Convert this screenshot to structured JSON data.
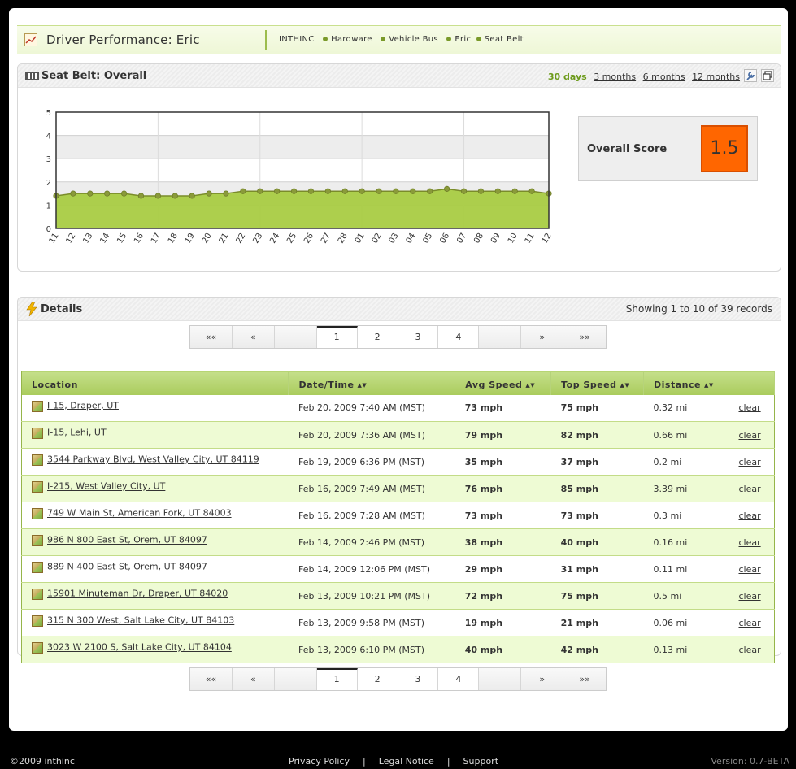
{
  "header": {
    "title": "Driver Performance: Eric",
    "breadcrumbs": [
      "INTHINC",
      "Hardware",
      "Vehicle Bus",
      "Eric",
      "Seat Belt"
    ]
  },
  "seatbelt_panel": {
    "title": "Seat Belt: Overall",
    "ranges": [
      "30 days",
      "3 months",
      "6 months",
      "12 months"
    ],
    "active_range": "30 days",
    "overall_label": "Overall Score",
    "overall_value": "1.5",
    "score_color": "#ff6600"
  },
  "chart_data": {
    "type": "area",
    "title": "",
    "xlabel": "",
    "ylabel": "",
    "ylim": [
      0,
      5
    ],
    "yticks": [
      "0",
      "1",
      "2",
      "3",
      "4",
      "5"
    ],
    "categories": [
      "11",
      "12",
      "13",
      "14",
      "15",
      "16",
      "17",
      "18",
      "19",
      "20",
      "21",
      "22",
      "23",
      "24",
      "25",
      "26",
      "27",
      "28",
      "01",
      "02",
      "03",
      "04",
      "05",
      "06",
      "07",
      "08",
      "09",
      "10",
      "11",
      "12"
    ],
    "values": [
      1.4,
      1.5,
      1.5,
      1.5,
      1.5,
      1.4,
      1.4,
      1.4,
      1.4,
      1.5,
      1.5,
      1.6,
      1.6,
      1.6,
      1.6,
      1.6,
      1.6,
      1.6,
      1.6,
      1.6,
      1.6,
      1.6,
      1.6,
      1.7,
      1.6,
      1.6,
      1.6,
      1.6,
      1.6,
      1.5
    ],
    "fill_color": "#a9cc43",
    "line_color": "#7a8c2a",
    "grid": true
  },
  "details": {
    "title": "Details",
    "showing": "Showing 1 to 10 of 39 records",
    "pager": {
      "first": "«‹",
      "prev": "«",
      "next": "»",
      "last": "»»",
      "pages": [
        "1",
        "2",
        "3",
        "4"
      ],
      "current": "1"
    },
    "columns": [
      "Location",
      "Date/Time",
      "Avg Speed",
      "Top Speed",
      "Distance"
    ],
    "clear_label": "clear",
    "rows": [
      {
        "location": "I-15, Draper, UT",
        "datetime": "Feb 20, 2009 7:40 AM (MST)",
        "avg": "73 mph",
        "top": "75 mph",
        "distance": "0.32 mi"
      },
      {
        "location": "I-15, Lehi, UT",
        "datetime": "Feb 20, 2009 7:36 AM (MST)",
        "avg": "79 mph",
        "top": "82 mph",
        "distance": "0.66 mi"
      },
      {
        "location": "3544 Parkway Blvd, West Valley City, UT 84119",
        "datetime": "Feb 19, 2009 6:36 PM (MST)",
        "avg": "35 mph",
        "top": "37 mph",
        "distance": "0.2 mi"
      },
      {
        "location": "I-215, West Valley City, UT",
        "datetime": "Feb 16, 2009 7:49 AM (MST)",
        "avg": "76 mph",
        "top": "85 mph",
        "distance": "3.39 mi"
      },
      {
        "location": "749 W Main St, American Fork, UT 84003",
        "datetime": "Feb 16, 2009 7:28 AM (MST)",
        "avg": "73 mph",
        "top": "73 mph",
        "distance": "0.3 mi"
      },
      {
        "location": "986 N 800 East St, Orem, UT 84097",
        "datetime": "Feb 14, 2009 2:46 PM (MST)",
        "avg": "38 mph",
        "top": "40 mph",
        "distance": "0.16 mi"
      },
      {
        "location": "889 N 400 East St, Orem, UT 84097",
        "datetime": "Feb 14, 2009 12:06 PM (MST)",
        "avg": "29 mph",
        "top": "31 mph",
        "distance": "0.11 mi"
      },
      {
        "location": "15901 Minuteman Dr, Draper, UT 84020",
        "datetime": "Feb 13, 2009 10:21 PM (MST)",
        "avg": "72 mph",
        "top": "75 mph",
        "distance": "0.5 mi"
      },
      {
        "location": "315 N 300 West, Salt Lake City, UT 84103",
        "datetime": "Feb 13, 2009 9:58 PM (MST)",
        "avg": "19 mph",
        "top": "21 mph",
        "distance": "0.06 mi"
      },
      {
        "location": "3023 W 2100 S, Salt Lake City, UT 84104",
        "datetime": "Feb 13, 2009 6:10 PM (MST)",
        "avg": "40 mph",
        "top": "42 mph",
        "distance": "0.13 mi"
      }
    ]
  },
  "footer": {
    "copyright": "©2009 inthinc",
    "links": [
      "Privacy Policy",
      "Legal Notice",
      "Support"
    ],
    "version": "Version: 0.7-BETA"
  }
}
